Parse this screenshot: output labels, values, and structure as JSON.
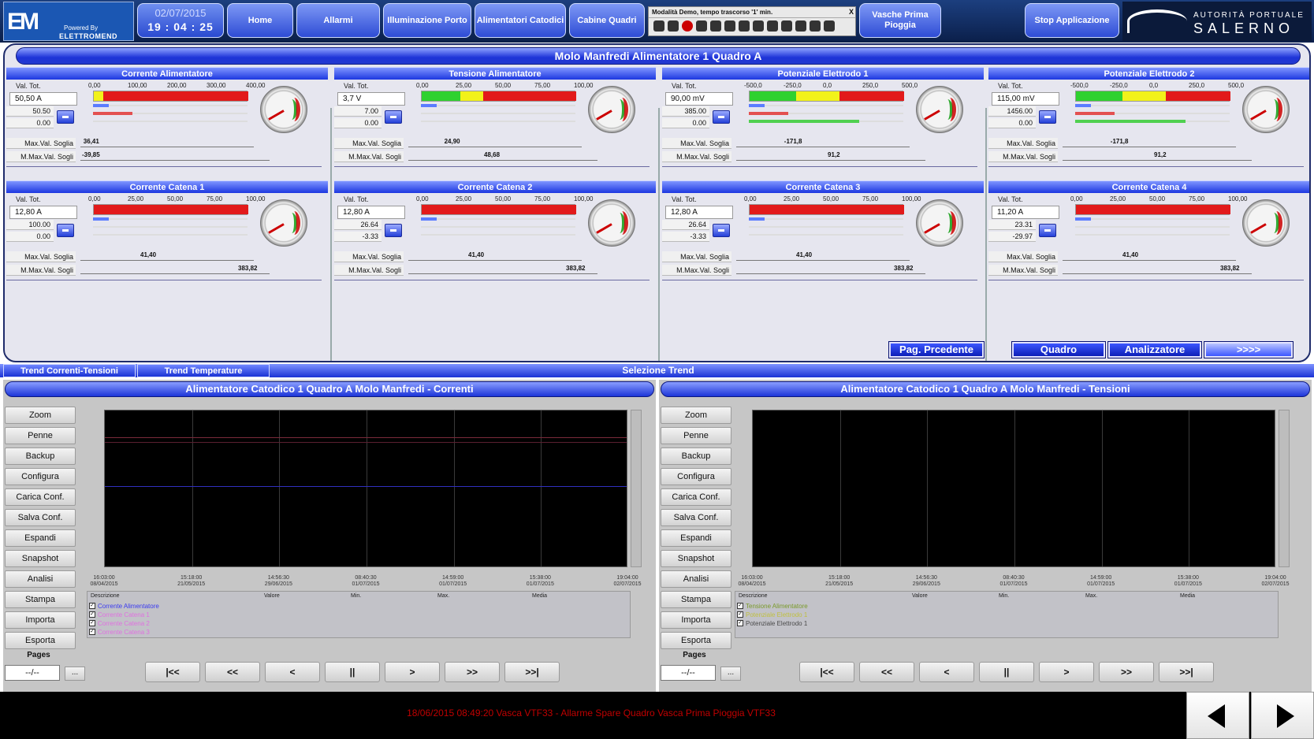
{
  "header": {
    "logo_powered": "Powered By",
    "logo_brand": "ELETTROMEND",
    "date": "02/07/2015",
    "time": "19 : 04 : 25",
    "nav": [
      "Home",
      "Allarmi",
      "Illuminazione Porto",
      "Alimentatori Catodici",
      "Cabine Quadri",
      "Vasche Prima Pioggia"
    ],
    "demo_text": "Modalità Demo, tempo trascorso '1' min.",
    "demo_close": "X",
    "stop_label": "Stop Applicazione",
    "authority_line1": "AUTORITÀ PORTUALE",
    "authority_line2": "SALERNO"
  },
  "page_title": "Molo Manfredi Alimentatore 1 Quadro A",
  "labels": {
    "val_tot": "Val. Tot.",
    "max_soglia": "Max.Val. Soglia",
    "mmax_soglia": "M.Max.Val. Sogli"
  },
  "panels": [
    {
      "title": "Corrente Alimentatore",
      "value": "50,50 A",
      "v1": "50.50",
      "v2": "0.00",
      "scale": [
        "0,00",
        "100,00",
        "200,00",
        "300,00",
        "400,00"
      ],
      "bar": {
        "green": 0.0,
        "yellow": 0.06,
        "red": 1.0
      },
      "max1": "36,41",
      "max2": "-39,85",
      "max1pos": 0.02,
      "max2pos": 0.01,
      "lines": [
        "#5b7cff",
        "#e35050",
        "#e0e0a0"
      ]
    },
    {
      "title": "Tensione Alimentatore",
      "value": "3,7 V",
      "v1": "7.00",
      "v2": "0.00",
      "scale": [
        "0,00",
        "25,00",
        "50,00",
        "75,00",
        "100,00"
      ],
      "bar": {
        "green": 0.25,
        "yellow": 0.4,
        "red": 1.0
      },
      "max1": "24,90",
      "max2": "48,68",
      "max1pos": 0.24,
      "max2pos": 0.48,
      "lines": [
        "#5b7cff",
        "#e0e0a0",
        "#e0e0a0"
      ]
    },
    {
      "title": "Potenziale Elettrodo 1",
      "value": "90,00 mV",
      "v1": "385.00",
      "v2": "0.00",
      "scale": [
        "-500,0",
        "-250,0",
        "0,0",
        "250,0",
        "500,0"
      ],
      "bar": {
        "green": 0.3,
        "yellow": 0.58,
        "red": 1.0
      },
      "max1": "-171,8",
      "max2": "91,2",
      "max1pos": 0.32,
      "max2pos": 0.58,
      "lines": [
        "#5b7cff",
        "#e35050",
        "#50d050"
      ]
    },
    {
      "title": "Potenziale Elettrodo 2",
      "value": "115,00 mV",
      "v1": "1456.00",
      "v2": "0.00",
      "scale": [
        "-500,0",
        "-250,0",
        "0,0",
        "250,0",
        "500,0"
      ],
      "bar": {
        "green": 0.3,
        "yellow": 0.58,
        "red": 1.0
      },
      "max1": "-171,8",
      "max2": "91,2",
      "max1pos": 0.32,
      "max2pos": 0.58,
      "lines": [
        "#5b7cff",
        "#e35050",
        "#50d050"
      ]
    },
    {
      "title": "Corrente Catena 1",
      "value": "12,80 A",
      "v1": "100.00",
      "v2": "0.00",
      "scale": [
        "0,00",
        "25,00",
        "50,00",
        "75,00",
        "100,00"
      ],
      "bar": {
        "green": 0.0,
        "yellow": 0.0,
        "red": 1.0
      },
      "max1": "41,40",
      "max2": "383,82",
      "max1pos": 0.4,
      "max2pos": 1.0,
      "lines": [
        "#5b7cff",
        "#e0e0a0",
        "#e0e0a0"
      ]
    },
    {
      "title": "Corrente Catena 2",
      "value": "12,80 A",
      "v1": "26.64",
      "v2": "-3.33",
      "scale": [
        "0,00",
        "25,00",
        "50,00",
        "75,00",
        "100,00"
      ],
      "bar": {
        "green": 0.0,
        "yellow": 0.0,
        "red": 1.0
      },
      "max1": "41,40",
      "max2": "383,82",
      "max1pos": 0.4,
      "max2pos": 1.0,
      "lines": [
        "#5b7cff",
        "#e0e0a0",
        "#e0e0a0"
      ]
    },
    {
      "title": "Corrente Catena 3",
      "value": "12,80 A",
      "v1": "26.64",
      "v2": "-3.33",
      "scale": [
        "0,00",
        "25,00",
        "50,00",
        "75,00",
        "100,00"
      ],
      "bar": {
        "green": 0.0,
        "yellow": 0.0,
        "red": 1.0
      },
      "max1": "41,40",
      "max2": "383,82",
      "max1pos": 0.4,
      "max2pos": 1.0,
      "lines": [
        "#5b7cff",
        "#e0e0a0",
        "#e0e0a0"
      ]
    },
    {
      "title": "Corrente Catena 4",
      "value": "11,20 A",
      "v1": "23.31",
      "v2": "-29.97",
      "scale": [
        "0,00",
        "25,00",
        "50,00",
        "75,00",
        "100,00"
      ],
      "bar": {
        "green": 0.0,
        "yellow": 0.0,
        "red": 1.0
      },
      "max1": "41,40",
      "max2": "383,82",
      "max1pos": 0.4,
      "max2pos": 1.0,
      "lines": [
        "#5b7cff",
        "#e0e0a0",
        "#e0e0a0"
      ]
    }
  ],
  "page_buttons": {
    "prev": "Pag. Prcedente",
    "quadro": "Quadro",
    "analizzatore": "Analizzatore",
    "next": ">>>>"
  },
  "trend_tabs": {
    "tab1": "Trend Correnti-Tensioni",
    "tab2": "Trend Temperature",
    "selection": "Selezione Trend"
  },
  "side_buttons": [
    "Zoom",
    "Penne",
    "Backup",
    "Configura",
    "Carica Conf.",
    "Salva Conf.",
    "Espandi",
    "Snapshot",
    "Analisi",
    "Stampa",
    "Importa",
    "Esporta"
  ],
  "legend_headers": [
    "Descrizione",
    "Valore",
    "Min.",
    "Max.",
    "Media"
  ],
  "nav_buttons": [
    "|<<",
    "<<",
    "<",
    "||",
    ">",
    ">>",
    ">>|"
  ],
  "pages_label": "Pages",
  "pages_value": "--/--",
  "pages_dots": "...",
  "xaxis": [
    {
      "time": "16:03:00",
      "date": "08/04/2015"
    },
    {
      "time": "15:18:00",
      "date": "21/05/2015"
    },
    {
      "time": "14:56:30",
      "date": "29/06/2015"
    },
    {
      "time": "08:40:30",
      "date": "01/07/2015"
    },
    {
      "time": "14:59:00",
      "date": "01/07/2015"
    },
    {
      "time": "15:38:00",
      "date": "01/07/2015"
    },
    {
      "time": "19:04:00",
      "date": "02/07/2015"
    }
  ],
  "trends": [
    {
      "title": "Alimentatore Catodico 1 Quadro A Molo Manfredi - Correnti",
      "legend": [
        {
          "name": "Corrente Alimentatore",
          "color": "#3a3af0"
        },
        {
          "name": "Corrente Catena 1",
          "color": "#e070e0"
        },
        {
          "name": "Corrente Catena 2",
          "color": "#e070e0"
        },
        {
          "name": "Corrente Catena 3",
          "color": "#e070e0"
        }
      ],
      "hlines": [
        "#7a2a3a",
        "#3030c0"
      ]
    },
    {
      "title": "Alimentatore Catodico 1 Quadro A Molo Manfredi - Tensioni",
      "legend": [
        {
          "name": "Tensione Alimentatore",
          "color": "#7a9a2a"
        },
        {
          "name": "Potenziale Elettrodo 1",
          "color": "#c0c040"
        },
        {
          "name": "Potenziale Elettrodo 1",
          "color": "#4a4a4a"
        }
      ],
      "hlines": []
    }
  ],
  "alarm_text": "18/06/2015 08:49:20 Vasca VTF33 - Allarme Spare  Quadro Vasca Prima Pioggia VTF33"
}
